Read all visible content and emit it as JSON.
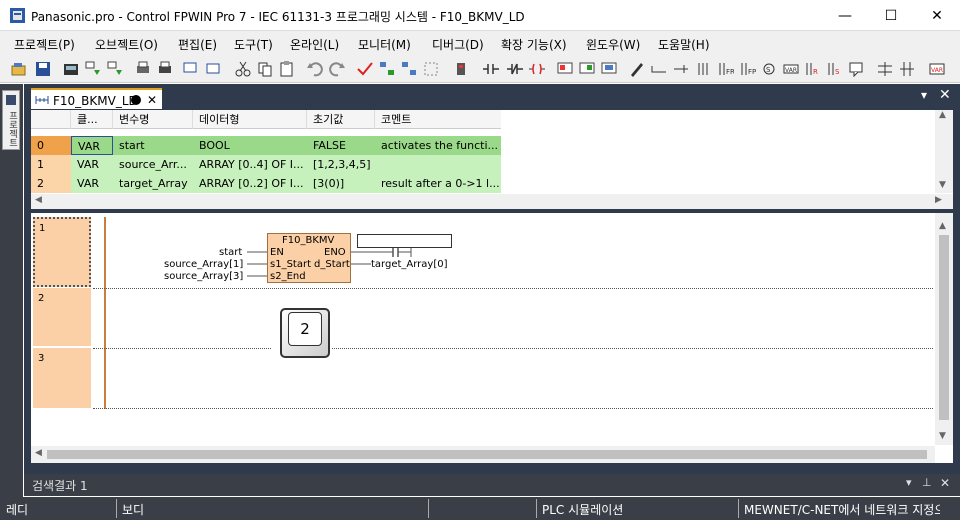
{
  "window": {
    "title": "Panasonic.pro - Control FPWIN Pro 7 - IEC 61131-3 프로그래밍 시스템 - F10_BKMV_LD",
    "min": "—",
    "max": "☐",
    "close": "✕"
  },
  "menu": [
    "프로젝트(P)",
    "오브젝트(O)",
    "편집(E)",
    "도구(T)",
    "온라인(L)",
    "모니터(M)",
    "디버그(D)",
    "확장 기능(X)",
    "윈도우(W)",
    "도움말(H)"
  ],
  "left_tab": "프로젝트",
  "doc_tab": {
    "label": "F10_BKMV_LD",
    "close": "✕"
  },
  "var_table": {
    "headers": [
      "",
      "클...",
      "변수명",
      "데이터형",
      "초기값",
      "코멘트"
    ],
    "rows": [
      {
        "idx": "0",
        "cls": "VAR",
        "name": "start",
        "type": "BOOL",
        "init": "FALSE",
        "comment": "activates the functi..."
      },
      {
        "idx": "1",
        "cls": "VAR",
        "name": "source_Arr...",
        "type": "ARRAY [0..4] OF I...",
        "init": "[1,2,3,4,5]",
        "comment": ""
      },
      {
        "idx": "2",
        "cls": "VAR",
        "name": "target_Array",
        "type": "ARRAY [0..2] OF I...",
        "init": "[3(0)]",
        "comment": "result after a 0->1 l..."
      }
    ]
  },
  "ladder": {
    "networks": [
      "1",
      "2",
      "3"
    ],
    "block": {
      "name": "F10_BKMV",
      "pin_en": "EN",
      "pin_eno": "ENO",
      "pin_s1": "s1_Start",
      "pin_d": "d_Start",
      "pin_s2": "s2_End",
      "in_en": "start",
      "in_s1": "source_Array[1]",
      "in_s2": "source_Array[3]",
      "out_d": "target_Array[0]"
    },
    "key_label": "2"
  },
  "bottom_panel": {
    "title": "검색결과 1"
  },
  "status": {
    "s1": "레디",
    "s2": "보디",
    "s3": "PLC 시뮬레이션",
    "s4": "MEWNET/C-NET에서 네트워크 지정으"
  },
  "colors": {
    "row_selected": "#9ad98a",
    "row_normal": "#c6f0bc",
    "idx_selected": "#f0a24a",
    "idx_normal": "#fbd4a8",
    "block_fill": "#fbd0a6",
    "network_num": "#fbd0a6",
    "tab_accent": "#e3a21a",
    "chrome_dark": "#3a3f47"
  }
}
